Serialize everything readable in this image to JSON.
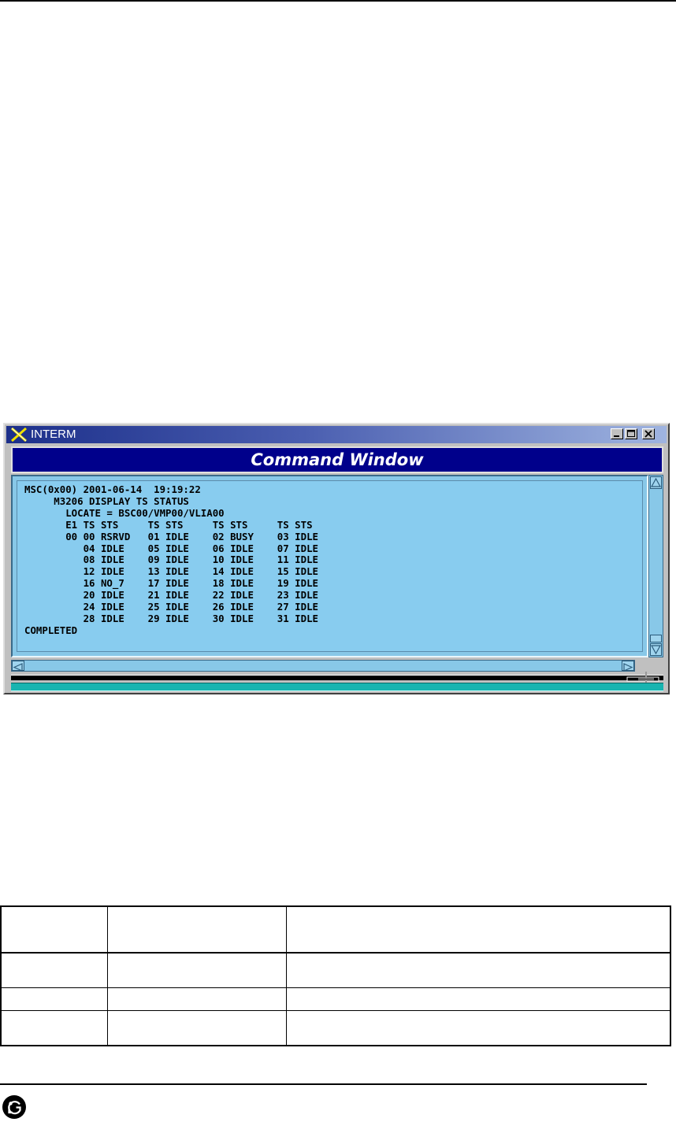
{
  "window": {
    "title": "INTERM",
    "header_title": "Command Window",
    "controls": [
      "minimize",
      "maximize",
      "close"
    ],
    "accent_colors": {
      "titlebar": "#1c2f8a",
      "header": "#00008b",
      "terminal_bg": "#88ccef",
      "status_bar": "#18b4b0"
    }
  },
  "terminal": {
    "lines": [
      "MSC(0x00) 2001-06-14  19:19:22",
      "     M3206 DISPLAY TS STATUS",
      "       LOCATE = BSC00/VMP00/VLIA00",
      "       E1 TS STS     TS STS     TS STS     TS STS",
      "       00 00 RSRVD   01 IDLE    02 BUSY    03 IDLE",
      "          04 IDLE    05 IDLE    06 IDLE    07 IDLE",
      "          08 IDLE    09 IDLE    10 IDLE    11 IDLE",
      "          12 IDLE    13 IDLE    14 IDLE    15 IDLE",
      "          16 NO_7    17 IDLE    18 IDLE    19 IDLE",
      "          20 IDLE    21 IDLE    22 IDLE    23 IDLE",
      "          24 IDLE    25 IDLE    26 IDLE    27 IDLE",
      "          28 IDLE    29 IDLE    30 IDLE    31 IDLE",
      "COMPLETED"
    ]
  },
  "table": {
    "rows": [
      [
        "",
        "",
        ""
      ],
      [
        "",
        "",
        ""
      ],
      [
        "",
        "",
        ""
      ],
      [
        "",
        "",
        ""
      ]
    ]
  },
  "footer": {
    "logo_icon": "lg-logo-icon"
  }
}
